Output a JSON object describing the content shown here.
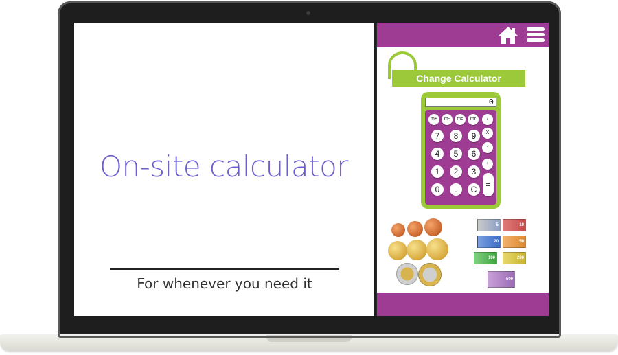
{
  "hero": {
    "title": "On-site calculator",
    "subtitle": "For whenever you need it"
  },
  "app": {
    "banner": "Change Calculator",
    "display_value": "0",
    "keys": {
      "mplus": "m+",
      "mminus": "m-",
      "mc": "mc",
      "mr": "mr",
      "divide": "/",
      "k7": "7",
      "k8": "8",
      "k9": "9",
      "multiply": "X",
      "k4": "4",
      "k5": "5",
      "k6": "6",
      "minus": "-",
      "k1": "1",
      "k2": "2",
      "k3": "3",
      "plus": "+",
      "k0": "0",
      "dot": ".",
      "clear": "C",
      "equals": "="
    },
    "notes": [
      "5",
      "10",
      "20",
      "50",
      "100",
      "200",
      "500"
    ]
  },
  "colors": {
    "brand_purple": "#9e3b93",
    "brand_green": "#9bc93a",
    "title_violet": "#6b5fd0"
  },
  "icons": [
    "home-icon",
    "menu-icon"
  ]
}
